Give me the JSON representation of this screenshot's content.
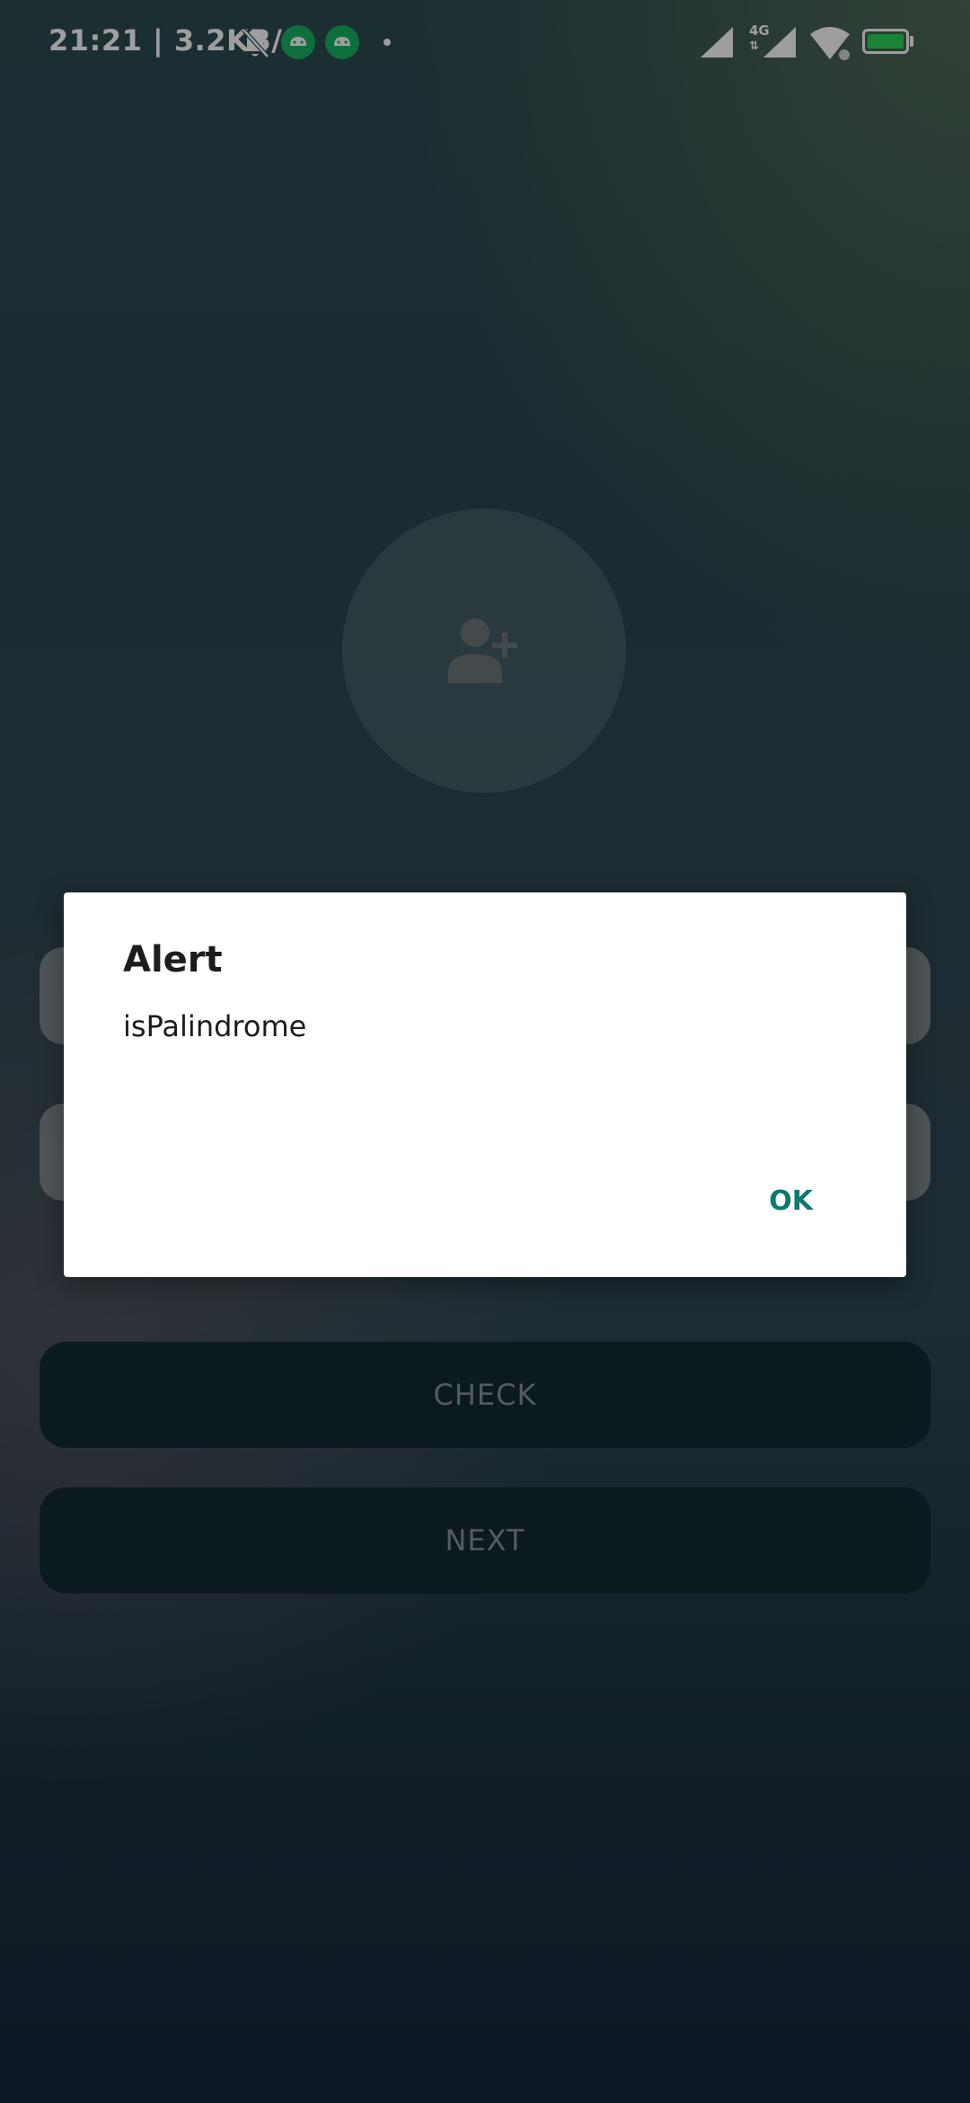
{
  "status_bar": {
    "time": "21:21",
    "net_speed": "3.2KB/s",
    "network_type": "4G",
    "icons": [
      "bell-off-icon",
      "android-icon",
      "android-icon",
      "dot-icon",
      "signal-icon",
      "signal-4g-icon",
      "wifi-icon",
      "battery-icon"
    ],
    "colors": {
      "android_badge": "#19b265",
      "battery": "#2bd45a"
    }
  },
  "avatar": {
    "icon": "add-user-icon"
  },
  "form": {
    "fields": [
      "name-input",
      "sentence-input"
    ]
  },
  "buttons": {
    "check_label": "CHECK",
    "next_label": "NEXT"
  },
  "dialog": {
    "title": "Alert",
    "message": "isPalindrome",
    "ok_label": "OK",
    "ok_color": "#0d7a6d"
  }
}
